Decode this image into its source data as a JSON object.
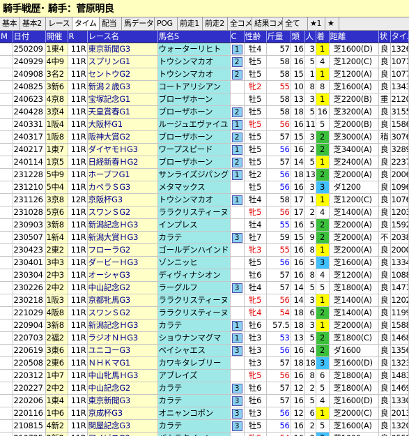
{
  "window_title": "騎手戦歴･ 騎手：菅原明良",
  "tabs": [
    "基本",
    "基本2",
    "レース",
    "タイム",
    "配当",
    "馬データ",
    "POG",
    "前走1",
    "前走2",
    "全コメ",
    "結果コメ",
    "全て",
    "★1",
    "★"
  ],
  "active_tab": 3,
  "columns": [
    "M",
    "日付",
    "開催",
    "R",
    "レース名",
    "馬名S",
    "C",
    "性齢",
    "斤量",
    "頭",
    "人",
    "着",
    "距離",
    "状",
    "タイム"
  ],
  "colors": {
    "win": "#ffff00",
    "second": "#3cc03c",
    "third": "#40c0ff",
    "horse_bg": "#9fe8e8",
    "race_bg": "#ffffc8",
    "header_bg": "#3030c8"
  },
  "rows": [
    {
      "date": "250209",
      "kai": "1東4",
      "r": "11R",
      "race": "東京新聞G3",
      "horse": "ウォーターリヒト",
      "c": "1",
      "age": "牡4",
      "kin": "57",
      "to": "16",
      "nin": "3",
      "chaku": "1",
      "dist": "芝1600(D)",
      "baba": "良",
      "time": "1326"
    },
    {
      "date": "240929",
      "kai": "4中9",
      "r": "11R",
      "race": "スプリンG1",
      "horse": "トウシンマカオ",
      "c": "2",
      "age": "牡5",
      "kin": "58",
      "to": "16",
      "nin": "5",
      "chaku": "4",
      "dist": "芝1200(C)",
      "baba": "良",
      "time": "1071"
    },
    {
      "date": "240908",
      "kai": "3名2",
      "r": "11R",
      "race": "セントウG2",
      "horse": "トウシンマカオ",
      "c": "2",
      "age": "牡5",
      "kin": "58",
      "to": "15",
      "nin": "1",
      "chaku": "1",
      "dist": "芝1200(A)",
      "baba": "良",
      "time": "1077"
    },
    {
      "date": "240825",
      "kai": "3新6",
      "r": "11R",
      "race": "新潟２歳G3",
      "horse": "コートアリシアン",
      "c": "",
      "age": "牝2",
      "kin": "55",
      "to": "10",
      "nin": "8",
      "chaku": "8",
      "dist": "芝1600(A)",
      "baba": "良",
      "time": "1343"
    },
    {
      "date": "240623",
      "kai": "4京8",
      "r": "11R",
      "race": "宝塚記念G1",
      "horse": "ブローザホーン",
      "c": "",
      "age": "牡5",
      "kin": "58",
      "to": "13",
      "nin": "3",
      "chaku": "1",
      "dist": "芝2200(B)",
      "baba": "重",
      "time": "2120"
    },
    {
      "date": "240428",
      "kai": "3京4",
      "r": "11R",
      "race": "天皇賞春G1",
      "horse": "ブローザホーン",
      "c": "2",
      "age": "牡5",
      "kin": "58",
      "to": "18",
      "nin": "5",
      "chaku": "16",
      "dist": "芝3200(A)",
      "baba": "良",
      "time": "3155"
    },
    {
      "date": "240331",
      "kai": "1阪4",
      "r": "11R",
      "race": "大阪杯G1",
      "horse": "ルージュエヴァイユ",
      "c": "1",
      "age": "牝5",
      "kin": "56",
      "to": "16",
      "nin": "11",
      "chaku": "5",
      "dist": "芝2000(B)",
      "baba": "良",
      "time": "1586"
    },
    {
      "date": "240317",
      "kai": "1阪8",
      "r": "11R",
      "race": "阪神大賞G2",
      "horse": "ブローザホーン",
      "c": "2",
      "age": "牡5",
      "kin": "57",
      "to": "15",
      "nin": "3",
      "chaku": "2",
      "dist": "芝3000(A)",
      "baba": "稍",
      "time": "3076"
    },
    {
      "date": "240217",
      "kai": "1東7",
      "r": "11R",
      "race": "ダイヤモＨG3",
      "horse": "ワープスピード",
      "c": "1",
      "age": "牡5",
      "kin": "56",
      "to": "16",
      "nin": "2",
      "chaku": "2",
      "dist": "芝3400(A)",
      "baba": "良",
      "time": "3289"
    },
    {
      "date": "240114",
      "kai": "1京5",
      "r": "11R",
      "race": "日経新春ＨG2",
      "horse": "ブローザホーン",
      "c": "2",
      "age": "牡5",
      "kin": "57",
      "to": "14",
      "nin": "5",
      "chaku": "1",
      "dist": "芝2400(A)",
      "baba": "良",
      "time": "2237"
    },
    {
      "date": "231228",
      "kai": "5中9",
      "r": "11R",
      "race": "ホープフG1",
      "horse": "サンライズジパング",
      "c": "1",
      "age": "牡2",
      "kin": "56",
      "to": "18",
      "nin": "13",
      "chaku": "2",
      "dist": "芝2000(A)",
      "baba": "良",
      "time": "2006"
    },
    {
      "date": "231210",
      "kai": "5中4",
      "r": "11R",
      "race": "カペラＳG3",
      "horse": "メタマックス",
      "c": "",
      "age": "牡5",
      "kin": "56",
      "to": "16",
      "nin": "3",
      "chaku": "3",
      "dist": "ダ1200",
      "baba": "良",
      "time": "1096"
    },
    {
      "date": "231126",
      "kai": "3京8",
      "r": "12R",
      "race": "京阪杯G3",
      "horse": "トウシンマカオ",
      "c": "1",
      "age": "牡4",
      "kin": "58",
      "to": "17",
      "nin": "1",
      "chaku": "1",
      "dist": "芝1200(C)",
      "baba": "良",
      "time": "1076"
    },
    {
      "date": "231028",
      "kai": "5京6",
      "r": "11R",
      "race": "スワンＳG2",
      "horse": "ララクリスティーヌ",
      "c": "",
      "age": "牝5",
      "kin": "56",
      "to": "17",
      "nin": "2",
      "chaku": "4",
      "dist": "芝1400(A)",
      "baba": "良",
      "time": "1203"
    },
    {
      "date": "230903",
      "kai": "3新8",
      "r": "11R",
      "race": "新潟記念ＨG3",
      "horse": "インプレス",
      "c": "",
      "age": "牡4",
      "kin": "55",
      "to": "16",
      "nin": "5",
      "chaku": "2",
      "dist": "芝2000(A)",
      "baba": "良",
      "time": "1592"
    },
    {
      "date": "230507",
      "kai": "1新4",
      "r": "11R",
      "race": "新潟大賞ＨG3",
      "horse": "カラテ",
      "c": "3",
      "age": "牡7",
      "kin": "59",
      "to": "15",
      "nin": "9",
      "chaku": "2",
      "dist": "芝2000(A)",
      "baba": "不",
      "time": "2038"
    },
    {
      "date": "230423",
      "kai": "2東2",
      "r": "11R",
      "race": "フローラG2",
      "horse": "ゴールデンハインド",
      "c": "",
      "age": "牝3",
      "kin": "55",
      "to": "16",
      "nin": "8",
      "chaku": "1",
      "dist": "芝2000(A)",
      "baba": "良",
      "time": "2000"
    },
    {
      "date": "230401",
      "kai": "3中3",
      "r": "11R",
      "race": "ダービーＨG3",
      "horse": "ゾンニッヒ",
      "c": "",
      "age": "牡5",
      "kin": "56",
      "to": "16",
      "nin": "5",
      "chaku": "3",
      "dist": "芝1600(A)",
      "baba": "良",
      "time": "1334"
    },
    {
      "date": "230304",
      "kai": "2中3",
      "r": "11R",
      "race": "オーシャG3",
      "horse": "ディヴィナシオン",
      "c": "",
      "age": "牡6",
      "kin": "57",
      "to": "16",
      "nin": "8",
      "chaku": "4",
      "dist": "芝1200(A)",
      "baba": "良",
      "time": "1088"
    },
    {
      "date": "230226",
      "kai": "2中2",
      "r": "11R",
      "race": "中山記念G2",
      "horse": "ラーグルフ",
      "c": "3",
      "age": "牡4",
      "kin": "57",
      "to": "14",
      "nin": "5",
      "chaku": "5",
      "dist": "芝1800(A)",
      "baba": "良",
      "time": "1471"
    },
    {
      "date": "230218",
      "kai": "1阪3",
      "r": "11R",
      "race": "京都牝馬G3",
      "horse": "ララクリスティーヌ",
      "c": "",
      "age": "牝5",
      "kin": "56",
      "to": "14",
      "nin": "3",
      "chaku": "1",
      "dist": "芝1400(A)",
      "baba": "良",
      "time": "1202"
    },
    {
      "date": "221029",
      "kai": "4阪8",
      "r": "11R",
      "race": "スワンＳG2",
      "horse": "ララクリスティーヌ",
      "c": "",
      "age": "牝4",
      "kin": "54",
      "to": "18",
      "nin": "6",
      "chaku": "2",
      "dist": "芝1400(A)",
      "baba": "良",
      "time": "1199"
    },
    {
      "date": "220904",
      "kai": "3新8",
      "r": "11R",
      "race": "新潟記念ＨG3",
      "horse": "カラテ",
      "c": "1",
      "age": "牡6",
      "kin": "57.5",
      "to": "18",
      "nin": "3",
      "chaku": "1",
      "dist": "芝2000(A)",
      "baba": "良",
      "time": "1588"
    },
    {
      "date": "220703",
      "kai": "2福2",
      "r": "11R",
      "race": "ラジオＮＨG3",
      "horse": "ショウナンマグマ",
      "c": "1",
      "age": "牡3",
      "kin": "53",
      "to": "13",
      "nin": "5",
      "chaku": "2",
      "dist": "芝1800(C)",
      "baba": "良",
      "time": "1468"
    },
    {
      "date": "220619",
      "kai": "3東6",
      "r": "11R",
      "race": "ユニコーG3",
      "horse": "ベイシャエス",
      "c": "3",
      "age": "牡3",
      "kin": "56",
      "to": "16",
      "nin": "4",
      "chaku": "2",
      "dist": "ダ1600",
      "baba": "良",
      "time": "1356"
    },
    {
      "date": "220508",
      "kai": "2東6",
      "r": "11R",
      "race": "ＮＨＫマG1",
      "horse": "カワキタレブリー",
      "c": "",
      "age": "牡3",
      "kin": "57",
      "to": "18",
      "nin": "18",
      "chaku": "3",
      "dist": "芝1600(D)",
      "baba": "良",
      "time": "1323"
    },
    {
      "date": "220312",
      "kai": "1中7",
      "r": "11R",
      "race": "中山牝馬ＨG3",
      "horse": "アブレイズ",
      "c": "",
      "age": "牝5",
      "kin": "56",
      "to": "16",
      "nin": "8",
      "chaku": "6",
      "dist": "芝1800(A)",
      "baba": "良",
      "time": "1483"
    },
    {
      "date": "220227",
      "kai": "2中2",
      "r": "11R",
      "race": "中山記念G2",
      "horse": "カラテ",
      "c": "3",
      "age": "牡6",
      "kin": "57",
      "to": "12",
      "nin": "2",
      "chaku": "5",
      "dist": "芝1800(A)",
      "baba": "良",
      "time": "1469"
    },
    {
      "date": "220206",
      "kai": "1東4",
      "r": "11R",
      "race": "東京新聞G3",
      "horse": "カラテ",
      "c": "3",
      "age": "牡6",
      "kin": "57",
      "to": "16",
      "nin": "5",
      "chaku": "4",
      "dist": "芝1600(D)",
      "baba": "良",
      "time": "1330"
    },
    {
      "date": "220116",
      "kai": "1中6",
      "r": "11R",
      "race": "京成杯G3",
      "horse": "オニャンコポン",
      "c": "3",
      "age": "牡3",
      "kin": "56",
      "to": "12",
      "nin": "6",
      "chaku": "1",
      "dist": "芝2000(C)",
      "baba": "良",
      "time": "2013"
    },
    {
      "date": "210815",
      "kai": "4新2",
      "r": "11R",
      "race": "関屋記念G3",
      "horse": "カラテ",
      "c": "3",
      "age": "牡5",
      "kin": "56",
      "to": "16",
      "nin": "2",
      "chaku": "5",
      "dist": "芝1600(A)",
      "baba": "良",
      "time": "1320"
    },
    {
      "date": "210725",
      "kai": "2新2",
      "r": "11R",
      "race": "アイビスG3",
      "horse": "バカラクイーン",
      "c": "",
      "age": "牝5",
      "kin": "54",
      "to": "16",
      "nin": "3",
      "chaku": "3",
      "dist": "芝1000",
      "baba": "良",
      "time": "0552"
    },
    {
      "date": "210207",
      "kai": "1東4",
      "r": "11R",
      "race": "東京新聞G3",
      "horse": "カラテ",
      "c": "3",
      "age": "牡5",
      "kin": "56",
      "to": "16",
      "nin": "4",
      "chaku": "1",
      "dist": "芝1600(D)",
      "baba": "良",
      "time": "1326"
    }
  ]
}
